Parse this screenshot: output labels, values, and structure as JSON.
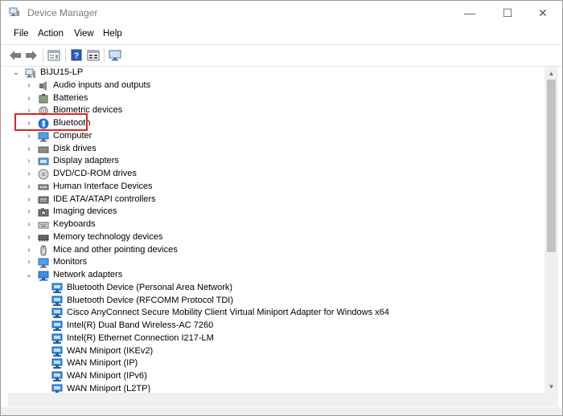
{
  "window": {
    "title": "Device Manager",
    "minimize": "—",
    "maximize": "☐",
    "close": "✕"
  },
  "menu": {
    "file": "File",
    "action": "Action",
    "view": "View",
    "help": "Help"
  },
  "toolbar": {
    "icons": [
      "back-arrow-icon",
      "forward-arrow-icon",
      "properties-icon",
      "help-icon",
      "view-list-icon",
      "monitor-icon"
    ]
  },
  "tree": {
    "root": "BIJU15-LP",
    "categories": [
      "Audio inputs and outputs",
      "Batteries",
      "Biometric devices",
      "Bluetooth",
      "Computer",
      "Disk drives",
      "Display adapters",
      "DVD/CD-ROM drives",
      "Human Interface Devices",
      "IDE ATA/ATAPI controllers",
      "Imaging devices",
      "Keyboards",
      "Memory technology devices",
      "Mice and other pointing devices",
      "Monitors",
      "Network adapters"
    ],
    "network_adapters": [
      "Bluetooth Device (Personal Area Network)",
      "Bluetooth Device (RFCOMM Protocol TDI)",
      "Cisco AnyConnect Secure Mobility Client Virtual Miniport Adapter for Windows x64",
      "Intel(R) Dual Band Wireless-AC 7260",
      "Intel(R) Ethernet Connection I217-LM",
      "WAN Miniport (IKEv2)",
      "WAN Miniport (IP)",
      "WAN Miniport (IPv6)",
      "WAN Miniport (L2TP)"
    ],
    "highlighted": "Bluetooth"
  },
  "colors": {
    "highlight_border": "#e32222",
    "network_icon": "#1e88e5"
  }
}
